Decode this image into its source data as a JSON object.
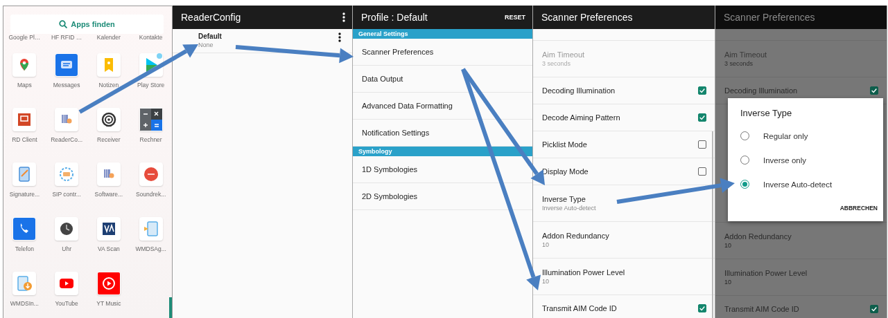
{
  "app_drawer": {
    "search": {
      "label": "Apps finden"
    },
    "cut_labels": [
      "Google Pl…",
      "HF RFID …",
      "Kalender",
      "Kontakte"
    ],
    "apps": [
      {
        "label": "Maps"
      },
      {
        "label": "Messages"
      },
      {
        "label": "Notizen"
      },
      {
        "label": "Play Store"
      },
      {
        "label": "RD Client"
      },
      {
        "label": "ReaderCo..."
      },
      {
        "label": "Receiver"
      },
      {
        "label": "Rechner"
      },
      {
        "label": "Signature..."
      },
      {
        "label": "SIP contr..."
      },
      {
        "label": "Software..."
      },
      {
        "label": "Soundrek..."
      },
      {
        "label": "Telefon"
      },
      {
        "label": "Uhr"
      },
      {
        "label": "VA Scan"
      },
      {
        "label": "WMDSAg..."
      },
      {
        "label": "WMDSIn..."
      },
      {
        "label": "YouTube"
      },
      {
        "label": "YT Music"
      }
    ]
  },
  "reader_config": {
    "title": "ReaderConfig",
    "profiles": [
      {
        "name": "Default",
        "summary": "None"
      }
    ]
  },
  "profile": {
    "title": "Profile : Default",
    "action": "RESET",
    "sections": [
      {
        "header": "General Settings",
        "items": [
          "Scanner Preferences",
          "Data Output",
          "Advanced Data Formatting",
          "Notification Settings"
        ]
      },
      {
        "header": "Symbology",
        "items": [
          "1D Symbologies",
          "2D Symbologies"
        ]
      }
    ]
  },
  "scanner_preferences": {
    "title": "Scanner Preferences",
    "rows": [
      {
        "kind": "text",
        "label": "Aim Timeout",
        "summary": "3 seconds",
        "disabled": true
      },
      {
        "kind": "checkbox",
        "label": "Decoding Illumination",
        "checked": true,
        "disabled": false
      },
      {
        "kind": "checkbox",
        "label": "Decode Aiming Pattern",
        "checked": true,
        "disabled": false
      },
      {
        "kind": "checkbox",
        "label": "Picklist Mode",
        "checked": false,
        "disabled": false
      },
      {
        "kind": "checkbox",
        "label": "Display Mode",
        "checked": false,
        "disabled": false
      },
      {
        "kind": "text",
        "label": "Inverse Type",
        "summary": "Inverse Auto-detect",
        "disabled": false
      },
      {
        "kind": "text",
        "label": "Addon Redundancy",
        "summary": "10",
        "disabled": false
      },
      {
        "kind": "text",
        "label": "Illumination Power Level",
        "summary": "10",
        "disabled": false
      },
      {
        "kind": "checkbox",
        "label": "Transmit AIM Code ID",
        "checked": true,
        "disabled": false
      }
    ]
  },
  "scanner_preferences_dialog_view": {
    "title": "Scanner Preferences",
    "rows_above": [
      {
        "kind": "text",
        "label": "Aim Timeout",
        "summary": "3 seconds",
        "disabled": true
      },
      {
        "kind": "checkbox",
        "label": "Decoding Illumination",
        "checked": true,
        "disabled": false
      }
    ],
    "dialog": {
      "title": "Inverse Type",
      "options": [
        {
          "label": "Regular only",
          "selected": false
        },
        {
          "label": "Inverse only",
          "selected": false
        },
        {
          "label": "Inverse Auto-detect",
          "selected": true
        }
      ],
      "button": "ABBRECHEN"
    },
    "rows_below": [
      {
        "kind": "text",
        "label": "Addon Redundancy",
        "summary": "10",
        "disabled": false
      },
      {
        "kind": "text",
        "label": "Illumination Power Level",
        "summary": "10",
        "disabled": false
      },
      {
        "kind": "checkbox",
        "label": "Transmit AIM Code ID",
        "checked": true,
        "disabled": false
      }
    ]
  }
}
